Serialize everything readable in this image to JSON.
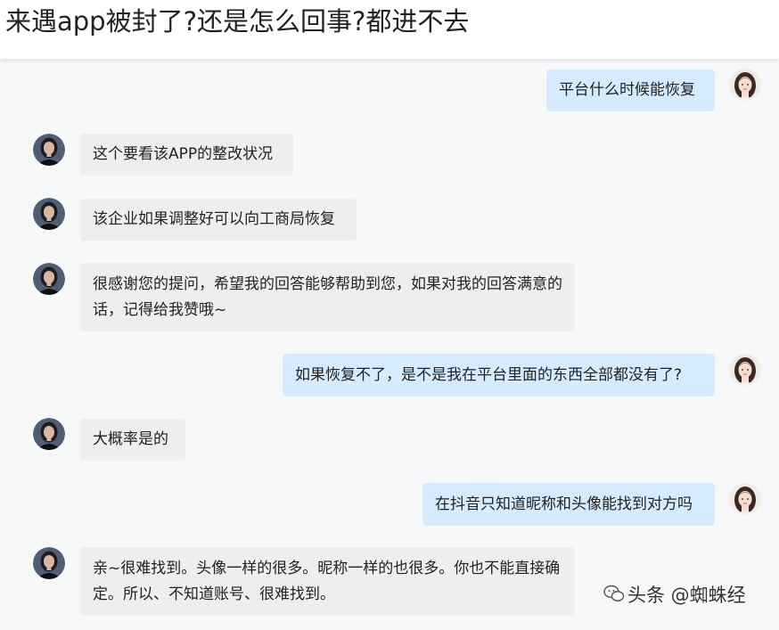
{
  "page": {
    "title": "来遇app被封了?还是怎么回事?都进不去"
  },
  "messages": [
    {
      "side": "right",
      "text": "平台什么时候能恢复"
    },
    {
      "side": "left",
      "text": "这个要看该APP的整改状况"
    },
    {
      "side": "left",
      "text": "该企业如果调整好可以向工商局恢复"
    },
    {
      "side": "left",
      "text": "很感谢您的提问，希望我的回答能够帮助到您，如果对我的回答满意的话，记得给我赞哦~"
    },
    {
      "side": "right",
      "text": "如果恢复不了，是不是我在平台里面的东西全部都没有了?"
    },
    {
      "side": "left",
      "text": "大概率是的"
    },
    {
      "side": "right",
      "text": "在抖音只知道昵称和头像能找到对方吗"
    },
    {
      "side": "left",
      "text": "亲~很难找到。头像一样的很多。昵称一样的也很多。你也不能直接确定。所以、不知道账号、很难找到。"
    }
  ],
  "watermark": {
    "text": "头条 @蜘蛛经",
    "logo_icon": "wechat-logo-icon"
  },
  "colors": {
    "user_bubble": "#d7ebfe",
    "expert_bubble": "#eeeeef",
    "background": "#f7f8fa",
    "header": "#ffffff"
  }
}
